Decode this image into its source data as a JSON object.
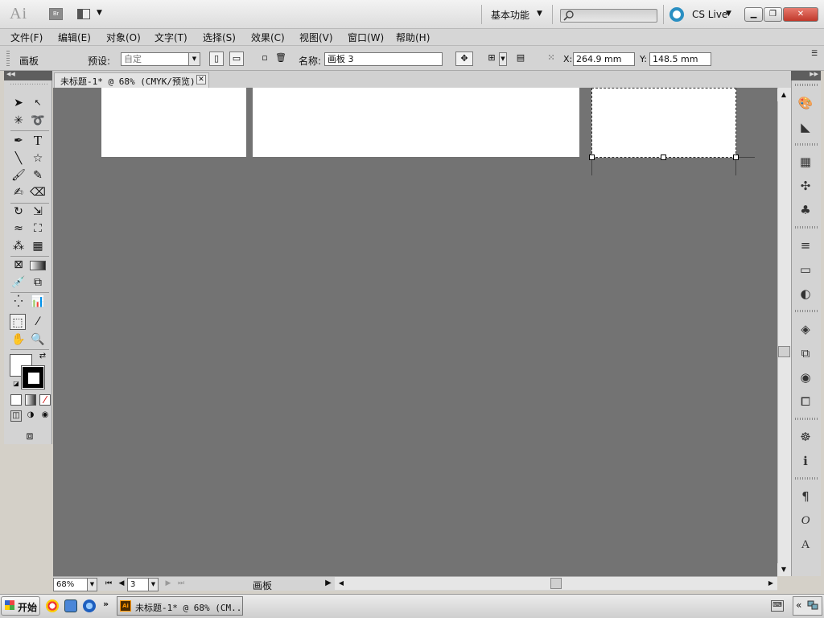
{
  "titlebar": {
    "app_logo": "Ai",
    "bridge_label": "Br",
    "workspace": "基本功能",
    "cs_live": "CS Live",
    "search_placeholder": ""
  },
  "menu": [
    "文件(F)",
    "编辑(E)",
    "对象(O)",
    "文字(T)",
    "选择(S)",
    "效果(C)",
    "视图(V)",
    "窗口(W)",
    "帮助(H)"
  ],
  "control": {
    "artboard_label": "画板",
    "preset_label": "预设:",
    "preset_value": "自定",
    "name_label": "名称:",
    "name_value": "画板 3",
    "x_label": "X:",
    "x_value": "264.9 mm",
    "y_label": "Y:",
    "y_value": "148.5 mm"
  },
  "document": {
    "tab_title": "未标题-1* @ 68% (CMYK/预览)"
  },
  "status": {
    "zoom": "68%",
    "page": "3",
    "status_text": "画板"
  },
  "taskbar": {
    "start": "开始",
    "task_item": "未标题-1* @ 68% (CM..."
  },
  "colors": {
    "canvas": "#737373",
    "panel": "#d3d3d3",
    "cs_live_accent": "#2a8fc2"
  },
  "icons": {
    "tools": [
      "selection-tool-icon",
      "direct-selection-tool-icon",
      "magic-wand-icon",
      "lasso-icon",
      "pen-tool-icon",
      "type-tool-icon",
      "line-tool-icon",
      "star-tool-icon",
      "paintbrush-icon",
      "pencil-icon",
      "blob-brush-icon",
      "eraser-icon",
      "rotate-icon",
      "scale-icon",
      "warp-icon",
      "free-transform-icon",
      "symbol-sprayer-icon",
      "graph-icon",
      "mesh-icon",
      "gradient-icon",
      "eyedropper-icon",
      "blend-icon",
      "symbol-icon",
      "column-graph-icon",
      "artboard-tool-icon",
      "slice-icon",
      "hand-icon",
      "zoom-icon"
    ],
    "dock": [
      "color-panel-icon",
      "color-guide-icon",
      "swatches-icon",
      "brushes-icon",
      "symbols-icon",
      "stroke-icon",
      "gradient-panel-icon",
      "transparency-icon",
      "layers-icon",
      "artboards-icon",
      "appearance-icon",
      "graphic-styles-icon",
      "navigator-icon",
      "info-icon",
      "paragraph-icon",
      "opentype-icon",
      "character-icon"
    ]
  }
}
